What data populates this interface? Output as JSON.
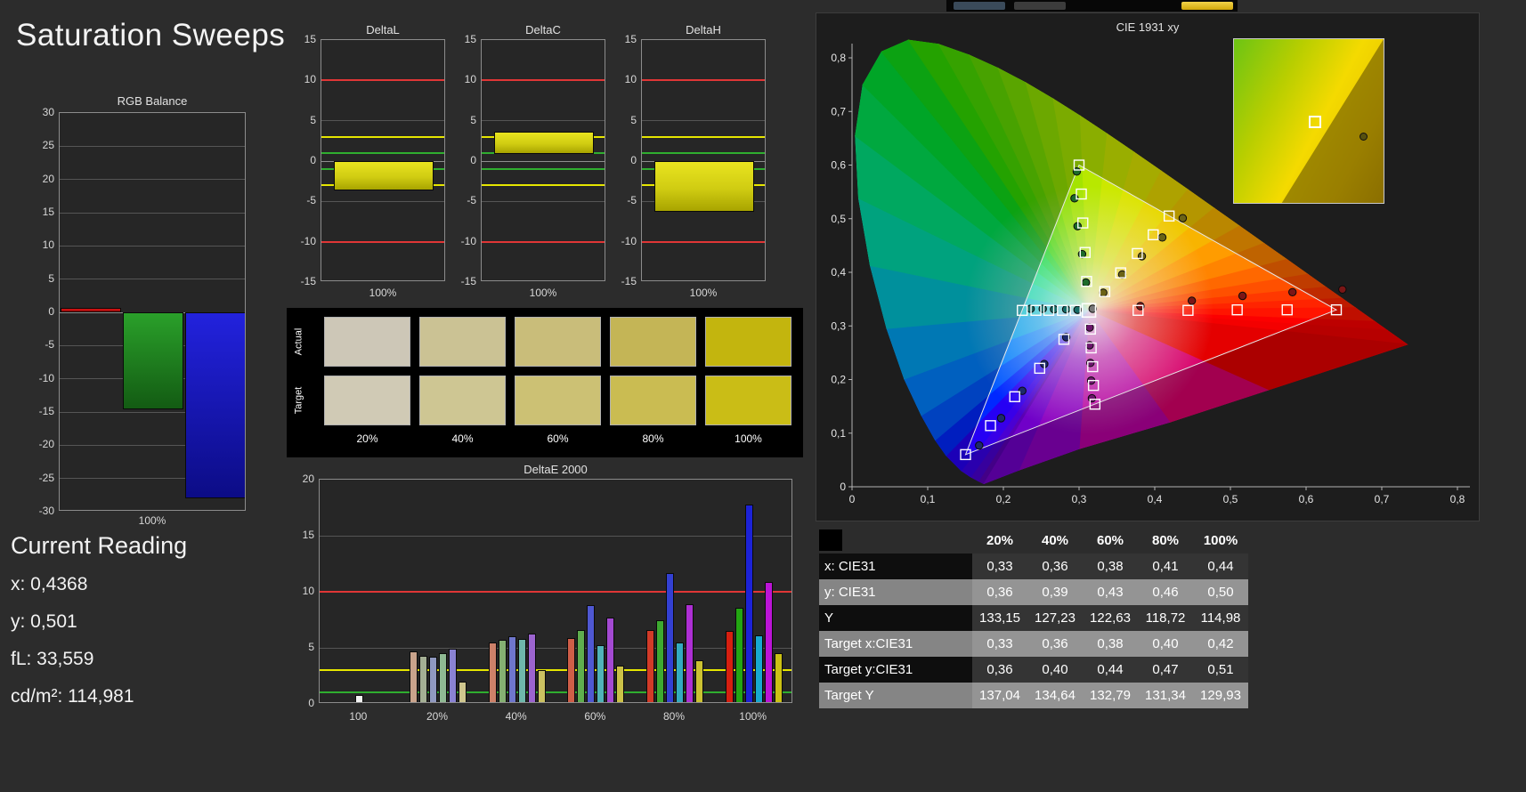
{
  "title": "Saturation Sweeps",
  "topbar": {
    "buttons": [
      "toolbar-button-1",
      "toolbar-button-2",
      "toolbar-button-yellow"
    ]
  },
  "current_reading": {
    "heading": "Current Reading",
    "lines": [
      "x: 0,4368",
      "y: 0,501",
      "fL: 33,559",
      "cd/m²: 114,981"
    ]
  },
  "swatch_panel": {
    "row_labels": [
      "Actual",
      "Target"
    ],
    "col_labels": [
      "20%",
      "40%",
      "60%",
      "80%",
      "100%"
    ],
    "actual_colors": [
      "#cdc7b7",
      "#cbc294",
      "#c9bd7a",
      "#c4b556",
      "#c3b50e"
    ],
    "target_colors": [
      "#d0cab5",
      "#cec693",
      "#ccc174",
      "#cabc52",
      "#cabd16"
    ]
  },
  "table": {
    "header": [
      "",
      "20%",
      "40%",
      "60%",
      "80%",
      "100%"
    ],
    "rows": [
      {
        "label": "x: CIE31",
        "values": [
          "0,33",
          "0,36",
          "0,38",
          "0,41",
          "0,44"
        ],
        "shaded": false
      },
      {
        "label": "y: CIE31",
        "values": [
          "0,36",
          "0,39",
          "0,43",
          "0,46",
          "0,50"
        ],
        "shaded": true
      },
      {
        "label": "Y",
        "values": [
          "133,15",
          "127,23",
          "122,63",
          "118,72",
          "114,98"
        ],
        "shaded": false
      },
      {
        "label": "Target x:CIE31",
        "values": [
          "0,33",
          "0,36",
          "0,38",
          "0,40",
          "0,42"
        ],
        "shaded": true
      },
      {
        "label": "Target y:CIE31",
        "values": [
          "0,36",
          "0,40",
          "0,44",
          "0,47",
          "0,51"
        ],
        "shaded": false
      },
      {
        "label": "Target Y",
        "values": [
          "137,04",
          "134,64",
          "132,79",
          "131,34",
          "129,93"
        ],
        "shaded": true
      }
    ]
  },
  "chart_data": [
    {
      "id": "rgb_balance",
      "type": "bar",
      "title": "RGB Balance",
      "xlabel": "100%",
      "ylim": [
        -30,
        30
      ],
      "ytick_step": 5,
      "series": [
        {
          "name": "red",
          "value": 0.7,
          "color": "#e01414",
          "color2": "#8f0a0a"
        },
        {
          "name": "green",
          "value": -14.6,
          "color": "#2aa02a",
          "color2": "#135b13"
        },
        {
          "name": "blue",
          "value": -28.0,
          "color": "#2222dd",
          "color2": "#0c0c86"
        }
      ]
    },
    {
      "id": "delta_l",
      "type": "bar",
      "title": "DeltaL",
      "xlabel": "100%",
      "ylim": [
        -15,
        15
      ],
      "ytick_step": 5,
      "bar": {
        "from": 0,
        "to": -3.6
      },
      "limit_lines": [
        {
          "value": 10,
          "color": "#e03636"
        },
        {
          "value": -10,
          "color": "#e03636"
        },
        {
          "value": 3,
          "color": "#e6e600"
        },
        {
          "value": -3,
          "color": "#e6e600"
        },
        {
          "value": 1,
          "color": "#2fae2f"
        },
        {
          "value": -1,
          "color": "#2fae2f"
        }
      ]
    },
    {
      "id": "delta_c",
      "type": "bar",
      "title": "DeltaC",
      "xlabel": "100%",
      "ylim": [
        -15,
        15
      ],
      "ytick_step": 5,
      "bar": {
        "from": 0.9,
        "to": 3.6
      },
      "limit_lines": [
        {
          "value": 10,
          "color": "#e03636"
        },
        {
          "value": -10,
          "color": "#e03636"
        },
        {
          "value": 3,
          "color": "#e6e600"
        },
        {
          "value": -3,
          "color": "#e6e600"
        },
        {
          "value": 1,
          "color": "#2fae2f"
        },
        {
          "value": -1,
          "color": "#2fae2f"
        }
      ]
    },
    {
      "id": "delta_h",
      "type": "bar",
      "title": "DeltaH",
      "xlabel": "100%",
      "ylim": [
        -15,
        15
      ],
      "ytick_step": 5,
      "bar": {
        "from": 0,
        "to": -6.3
      },
      "limit_lines": [
        {
          "value": 10,
          "color": "#e03636"
        },
        {
          "value": -10,
          "color": "#e03636"
        },
        {
          "value": 3,
          "color": "#e6e600"
        },
        {
          "value": -3,
          "color": "#e6e600"
        },
        {
          "value": 1,
          "color": "#2fae2f"
        },
        {
          "value": -1,
          "color": "#2fae2f"
        }
      ]
    },
    {
      "id": "delta_e_2000",
      "type": "grouped-bar",
      "title": "DeltaE 2000",
      "ylim": [
        0,
        20
      ],
      "ytick_step": 5,
      "limit_lines": [
        {
          "value": 10,
          "color": "#e03636"
        },
        {
          "value": 3,
          "color": "#e6e600"
        },
        {
          "value": 1,
          "color": "#2fae2f"
        }
      ],
      "groups": [
        {
          "label": "100",
          "bars": [
            {
              "value": 0.8,
              "color": "#f2f2f2"
            }
          ]
        },
        {
          "label": "20%",
          "bars": [
            {
              "value": 4.7,
              "color": "#c9a38c"
            },
            {
              "value": 4.3,
              "color": "#a4af94"
            },
            {
              "value": 4.2,
              "color": "#9099c0"
            },
            {
              "value": 4.5,
              "color": "#8fb993"
            },
            {
              "value": 4.9,
              "color": "#8a82d2"
            },
            {
              "value": 2.0,
              "color": "#cfc68e"
            }
          ]
        },
        {
          "label": "40%",
          "bars": [
            {
              "value": 5.5,
              "color": "#cd8169"
            },
            {
              "value": 5.7,
              "color": "#85b072"
            },
            {
              "value": 6.0,
              "color": "#6f76cc"
            },
            {
              "value": 5.8,
              "color": "#6fb8ab"
            },
            {
              "value": 6.3,
              "color": "#9c64cf"
            },
            {
              "value": 3.0,
              "color": "#cbc161"
            }
          ]
        },
        {
          "label": "60%",
          "bars": [
            {
              "value": 5.9,
              "color": "#cf5e48"
            },
            {
              "value": 6.6,
              "color": "#5fae4e"
            },
            {
              "value": 8.8,
              "color": "#4f58d2"
            },
            {
              "value": 5.2,
              "color": "#50b3b8"
            },
            {
              "value": 7.7,
              "color": "#a44ad2"
            },
            {
              "value": 3.4,
              "color": "#cbc148"
            }
          ]
        },
        {
          "label": "80%",
          "bars": [
            {
              "value": 6.6,
              "color": "#d23b28"
            },
            {
              "value": 7.5,
              "color": "#3daa30"
            },
            {
              "value": 11.7,
              "color": "#3340d2"
            },
            {
              "value": 5.5,
              "color": "#33abc0"
            },
            {
              "value": 8.9,
              "color": "#ad2fd4"
            },
            {
              "value": 3.9,
              "color": "#cbc132"
            }
          ]
        },
        {
          "label": "100%",
          "bars": [
            {
              "value": 6.5,
              "color": "#d61f10"
            },
            {
              "value": 8.6,
              "color": "#23a612"
            },
            {
              "value": 17.8,
              "color": "#1c22d6"
            },
            {
              "value": 6.1,
              "color": "#18a9d0"
            },
            {
              "value": 10.9,
              "color": "#bb14d6"
            },
            {
              "value": 4.5,
              "color": "#cbc114"
            }
          ]
        }
      ]
    },
    {
      "id": "cie_1931",
      "type": "scatter",
      "title": "CIE 1931 xy",
      "xlim": [
        0,
        0.8
      ],
      "ylim": [
        0,
        0.8
      ],
      "tick_labels": [
        "0",
        "0,1",
        "0,2",
        "0,3",
        "0,4",
        "0,5",
        "0,6",
        "0,7",
        "0,8"
      ],
      "white_point": [
        0.313,
        0.329
      ],
      "gamut_triangle": [
        [
          0.64,
          0.33
        ],
        [
          0.3,
          0.6
        ],
        [
          0.15,
          0.06
        ]
      ],
      "target_squares": [
        [
          0.378,
          0.329
        ],
        [
          0.444,
          0.329
        ],
        [
          0.509,
          0.33
        ],
        [
          0.575,
          0.33
        ],
        [
          0.64,
          0.33
        ],
        [
          0.31,
          0.383
        ],
        [
          0.308,
          0.437
        ],
        [
          0.305,
          0.492
        ],
        [
          0.303,
          0.546
        ],
        [
          0.3,
          0.6
        ],
        [
          0.28,
          0.275
        ],
        [
          0.248,
          0.221
        ],
        [
          0.215,
          0.168
        ],
        [
          0.183,
          0.114
        ],
        [
          0.15,
          0.06
        ],
        [
          0.295,
          0.329
        ],
        [
          0.278,
          0.329
        ],
        [
          0.26,
          0.329
        ],
        [
          0.243,
          0.329
        ],
        [
          0.225,
          0.329
        ],
        [
          0.315,
          0.294
        ],
        [
          0.316,
          0.259
        ],
        [
          0.318,
          0.224
        ],
        [
          0.319,
          0.189
        ],
        [
          0.321,
          0.154
        ],
        [
          0.334,
          0.364
        ],
        [
          0.355,
          0.399
        ],
        [
          0.377,
          0.435
        ],
        [
          0.398,
          0.47
        ],
        [
          0.419,
          0.505
        ]
      ],
      "measured_points": [
        {
          "xy": [
            0.381,
            0.337
          ],
          "c": "#7a1616"
        },
        {
          "xy": [
            0.449,
            0.347
          ],
          "c": "#7a1616"
        },
        {
          "xy": [
            0.516,
            0.356
          ],
          "c": "#7a1616"
        },
        {
          "xy": [
            0.582,
            0.363
          ],
          "c": "#7a1616"
        },
        {
          "xy": [
            0.648,
            0.368
          ],
          "c": "#7a1616"
        },
        {
          "xy": [
            0.309,
            0.381
          ],
          "c": "#1d6b2a"
        },
        {
          "xy": [
            0.304,
            0.434
          ],
          "c": "#1d6b2a"
        },
        {
          "xy": [
            0.298,
            0.486
          ],
          "c": "#1d6b2a"
        },
        {
          "xy": [
            0.294,
            0.538
          ],
          "c": "#1d6b2a"
        },
        {
          "xy": [
            0.297,
            0.588
          ],
          "c": "#1d6b2a"
        },
        {
          "xy": [
            0.283,
            0.279
          ],
          "c": "#1d2a6b"
        },
        {
          "xy": [
            0.254,
            0.229
          ],
          "c": "#1d2a6b"
        },
        {
          "xy": [
            0.225,
            0.179
          ],
          "c": "#1d2a6b"
        },
        {
          "xy": [
            0.197,
            0.128
          ],
          "c": "#1d2a6b"
        },
        {
          "xy": [
            0.168,
            0.077
          ],
          "c": "#1d2a6b"
        },
        {
          "xy": [
            0.298,
            0.33
          ],
          "c": "#166b66"
        },
        {
          "xy": [
            0.283,
            0.331
          ],
          "c": "#166b66"
        },
        {
          "xy": [
            0.267,
            0.331
          ],
          "c": "#166b66"
        },
        {
          "xy": [
            0.252,
            0.332
          ],
          "c": "#166b66"
        },
        {
          "xy": [
            0.236,
            0.332
          ],
          "c": "#166b66"
        },
        {
          "xy": [
            0.314,
            0.297
          ],
          "c": "#6b166b"
        },
        {
          "xy": [
            0.314,
            0.264
          ],
          "c": "#6b166b"
        },
        {
          "xy": [
            0.315,
            0.231
          ],
          "c": "#6b166b"
        },
        {
          "xy": [
            0.316,
            0.198
          ],
          "c": "#6b166b"
        },
        {
          "xy": [
            0.317,
            0.165
          ],
          "c": "#6b166b"
        },
        {
          "xy": [
            0.332,
            0.362
          ],
          "c": "#6b6316"
        },
        {
          "xy": [
            0.357,
            0.396
          ],
          "c": "#6b6316"
        },
        {
          "xy": [
            0.383,
            0.43
          ],
          "c": "#6b6316"
        },
        {
          "xy": [
            0.41,
            0.465
          ],
          "c": "#6b6316"
        },
        {
          "xy": [
            0.437,
            0.501
          ],
          "c": "#6b6316"
        },
        {
          "xy": [
            0.318,
            0.332
          ],
          "c": "#777777"
        }
      ],
      "inset": {
        "square": [
          0.5,
          0.47
        ],
        "circle": [
          0.84,
          0.57
        ]
      }
    }
  ]
}
